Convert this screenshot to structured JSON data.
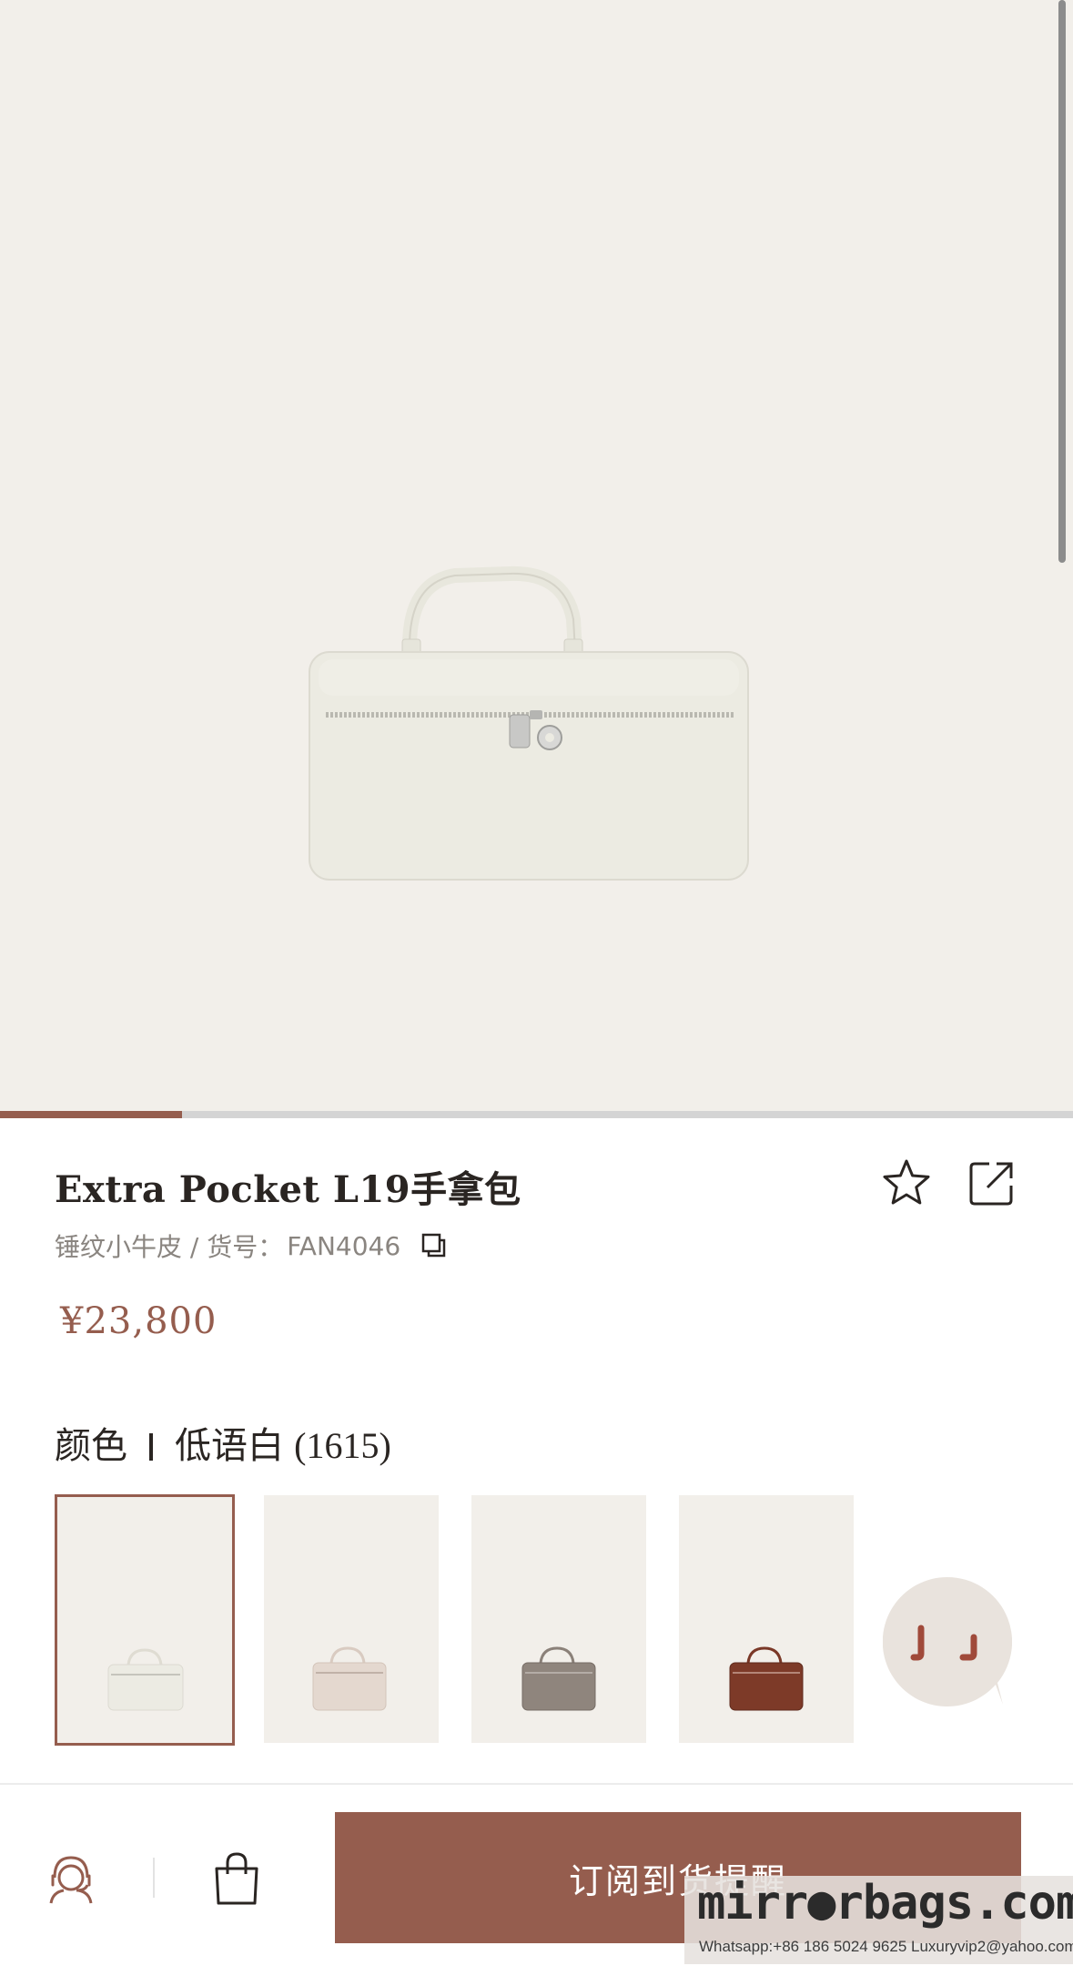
{
  "product": {
    "title": "Extra Pocket L19手拿包",
    "material": "锤纹小牛皮 / 货号：",
    "sku": "FAN4046",
    "price": "¥23,800"
  },
  "gallery": {
    "image_index_progress": 0.17
  },
  "color_selector": {
    "label": "颜色",
    "selected_name": "低语白",
    "selected_code": "(1615)",
    "swatches": [
      {
        "name": "低语白",
        "color": "#ecebe3"
      },
      {
        "name": "beige",
        "color": "#e4d8cf"
      },
      {
        "name": "taupe",
        "color": "#8f857d"
      },
      {
        "name": "brown",
        "color": "#7d3a28"
      }
    ]
  },
  "bottom_bar": {
    "subscribe_label": "订阅到货提醒"
  },
  "watermark": {
    "brand": "mirr●rbags.com",
    "contact": "Whatsapp:+86 186 5024 9625   Luxuryvip2@yahoo.com"
  },
  "icons": {
    "favorite": "star-icon",
    "share": "share-icon",
    "copy": "copy-icon",
    "customer_service": "customer-service-icon",
    "bag": "shopping-bag-icon",
    "chat": "chat-icon"
  },
  "colors": {
    "accent": "#955d4e",
    "hero_bg": "#f2efea"
  }
}
